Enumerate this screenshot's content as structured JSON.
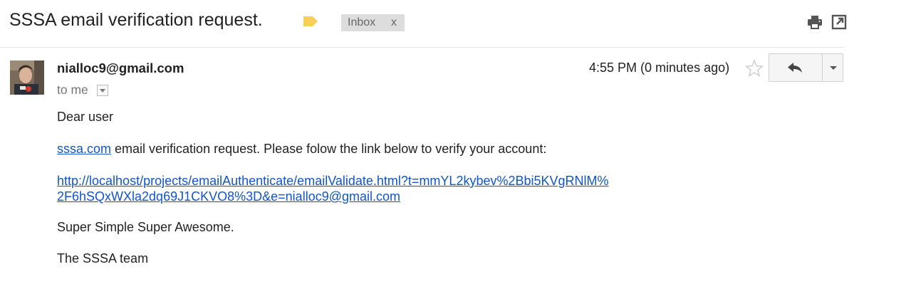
{
  "header": {
    "subject": "SSSA email verification request.",
    "label_chip": {
      "text": "Inbox",
      "close": "x"
    },
    "icons": {
      "label": "label-icon",
      "print": "print-icon",
      "popout": "new-window-icon"
    }
  },
  "message": {
    "sender": "nialloc9@gmail.com",
    "to": "to me",
    "time": "4:55 PM (0 minutes ago)",
    "icons": {
      "star": "star-icon",
      "reply": "reply-icon",
      "more": "chevron-down-icon"
    },
    "body": {
      "greeting": "Dear user",
      "intro_link": "sssa.com",
      "intro_text": " email verification request. Please folow the link below to verify your account:",
      "verify_link_line1": "http://localhost/projects/emailAuthenticate/emailValidate.html?t=mmYL2kybev%2Bbi5KVgRNlM%",
      "verify_link_line2": "2F6hSQxWXla2dq69J1CKVO8%3D&e=nialloc9@gmail.com",
      "tagline": "Super Simple Super Awesome.",
      "signature": "The SSSA team"
    }
  },
  "colors": {
    "link": "#1155cc",
    "label_icon": "#f6d05a",
    "chip_bg": "#dddddd"
  }
}
